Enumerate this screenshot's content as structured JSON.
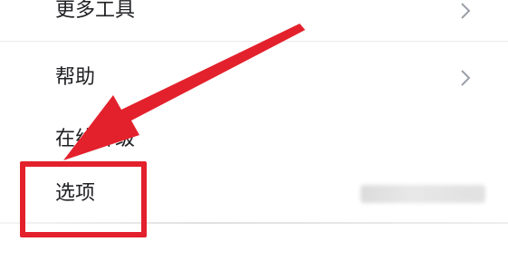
{
  "menu": {
    "items": [
      {
        "label": "更多工具",
        "has_submenu": true
      },
      {
        "label": "帮助",
        "has_submenu": true
      },
      {
        "label": "在线升级",
        "has_submenu": false
      },
      {
        "label": "选项",
        "has_submenu": false
      }
    ]
  },
  "annotation": {
    "color": "#e3212c",
    "target": "选项"
  }
}
